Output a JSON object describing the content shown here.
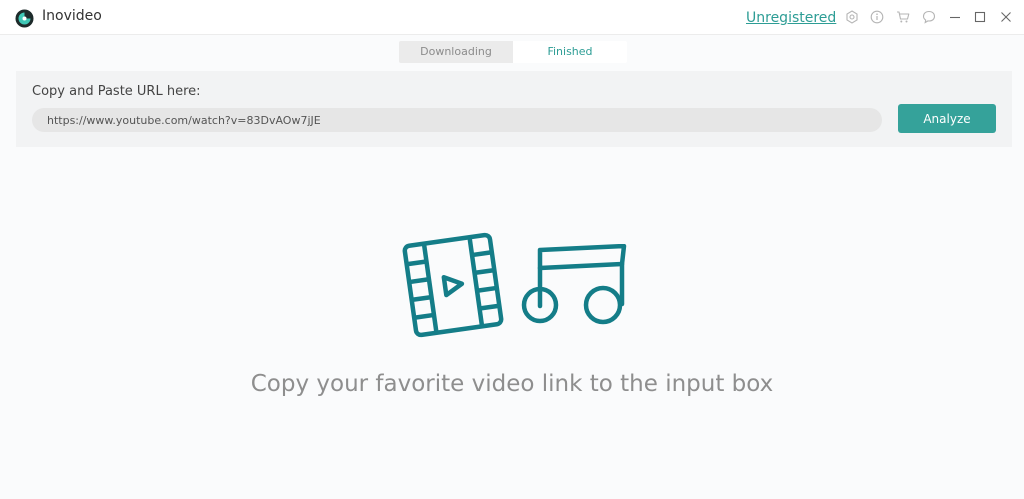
{
  "app": {
    "title": "Inovideo",
    "accent_color": "#2d9d95"
  },
  "titlebar": {
    "register_label": "Unregistered",
    "icons": [
      "settings-icon",
      "info-icon",
      "cart-icon",
      "feedback-icon",
      "minimize-icon",
      "maximize-icon",
      "close-icon"
    ]
  },
  "tabs": {
    "downloading_label": "Downloading",
    "finished_label": "Finished",
    "active": "Finished"
  },
  "url_panel": {
    "label": "Copy and Paste URL here:",
    "input_value": "https://www.youtube.com/watch?v=83DvAOw7jJE",
    "analyze_label": "Analyze"
  },
  "empty_state": {
    "icons": [
      "video-film-icon",
      "music-note-icon"
    ],
    "message": "Copy your favorite video link to the input box"
  }
}
